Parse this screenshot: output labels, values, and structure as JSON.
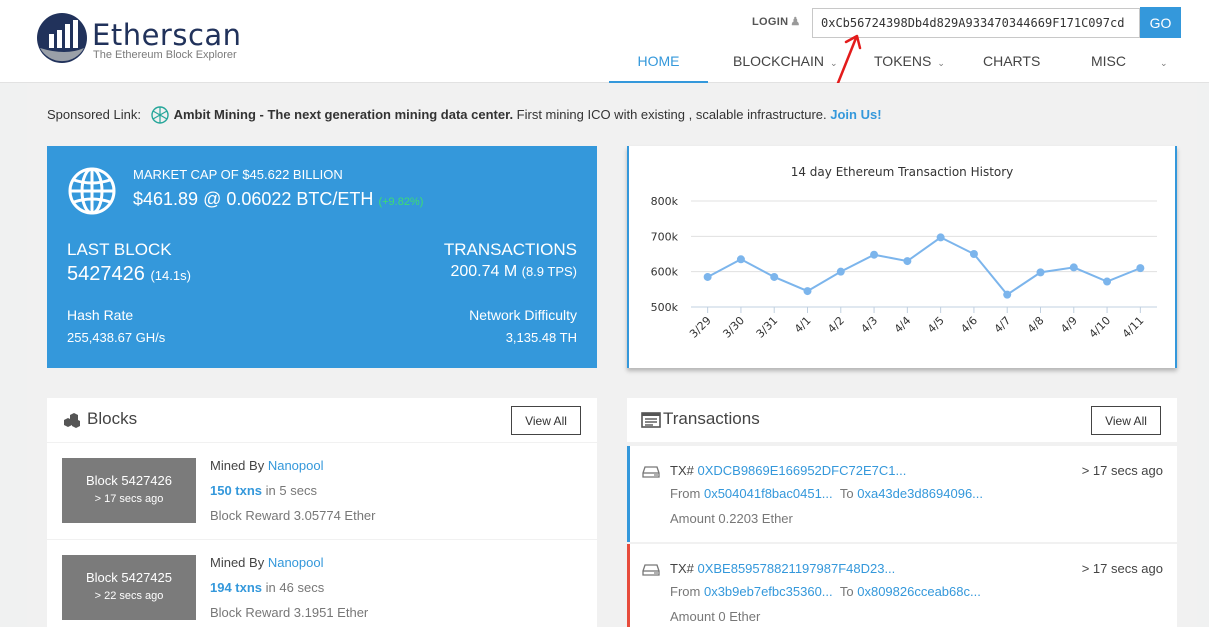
{
  "brand": {
    "name": "Etherscan",
    "tagline": "The Ethereum Block Explorer",
    "color": "#21325b"
  },
  "header": {
    "login_label": "LOGIN",
    "search_value": "0xCb56724398Db4d829A933470344669F171C097cd",
    "go_label": "GO"
  },
  "nav": {
    "items": [
      {
        "label": "HOME",
        "active": true
      },
      {
        "label": "BLOCKCHAIN",
        "caret": true
      },
      {
        "label": "TOKENS",
        "caret": true
      },
      {
        "label": "CHARTS"
      },
      {
        "label": "MISC",
        "caret": true
      }
    ]
  },
  "sponsor": {
    "prefix": "Sponsored Link:",
    "name": "Ambit Mining",
    "headline": " - The next generation mining data center.",
    "text": " First mining ICO with existing , scalable infrastructure.",
    "cta": "Join Us!"
  },
  "market": {
    "market_cap": "MARKET CAP OF $45.622 BILLION",
    "price": "$461.89 @ 0.06022 BTC/ETH",
    "change": "(+9.82%)",
    "last_block_label": "LAST BLOCK",
    "last_block_value": "5427426",
    "last_block_time": "(14.1s)",
    "transactions_label": "TRANSACTIONS",
    "transactions_value": "200.74 M",
    "transactions_tps": "(8.9 TPS)",
    "hash_rate_label": "Hash Rate",
    "hash_rate_value": "255,438.67 GH/s",
    "difficulty_label": "Network Difficulty",
    "difficulty_value": "3,135.48 TH",
    "accent": "#3498db"
  },
  "chart_data": {
    "type": "line",
    "title": "14 day Ethereum Transaction History",
    "categories": [
      "3/29",
      "3/30",
      "3/31",
      "4/1",
      "4/2",
      "4/3",
      "4/4",
      "4/5",
      "4/6",
      "4/7",
      "4/8",
      "4/9",
      "4/10",
      "4/11"
    ],
    "values": [
      585,
      635,
      585,
      545,
      600,
      648,
      630,
      697,
      650,
      535,
      598,
      612,
      572,
      610
    ],
    "ylim": [
      500,
      800
    ],
    "yticks": [
      "500k",
      "600k",
      "700k",
      "800k"
    ],
    "ytick_values": [
      500,
      600,
      700,
      800
    ],
    "grid": true,
    "color": "#7cb5ec"
  },
  "blocks_panel": {
    "title": "Blocks",
    "view_all": "View All",
    "rows": [
      {
        "block": "Block 5427426",
        "age": "> 17 secs ago",
        "mined_by_label": "Mined By",
        "miner": "Nanopool",
        "txns": "150 txns",
        "txns_suffix": " in 5 secs",
        "reward": "Block Reward 3.05774 Ether"
      },
      {
        "block": "Block 5427425",
        "age": "> 22 secs ago",
        "mined_by_label": "Mined By",
        "miner": "Nanopool",
        "txns": "194 txns",
        "txns_suffix": " in 46 secs",
        "reward": "Block Reward 3.1951 Ether"
      }
    ]
  },
  "tx_panel": {
    "title": "Transactions",
    "view_all": "View All",
    "rows": [
      {
        "tx_label": "TX#",
        "hash": "0XDCB9869E166952DFC72E7C1...",
        "age": "> 17 secs ago",
        "from_label": "From",
        "from": "0x504041f8bac0451...",
        "to_label": "To",
        "to": "0xa43de3d8694096...",
        "amount": "Amount 0.2203 Ether"
      },
      {
        "tx_label": "TX#",
        "hash": "0XBE859578821197987F48D23...",
        "age": "> 17 secs ago",
        "from_label": "From",
        "from": "0x3b9eb7efbc35360...",
        "to_label": "To",
        "to": "0x809826cceab68c...",
        "amount": "Amount 0 Ether"
      }
    ]
  }
}
